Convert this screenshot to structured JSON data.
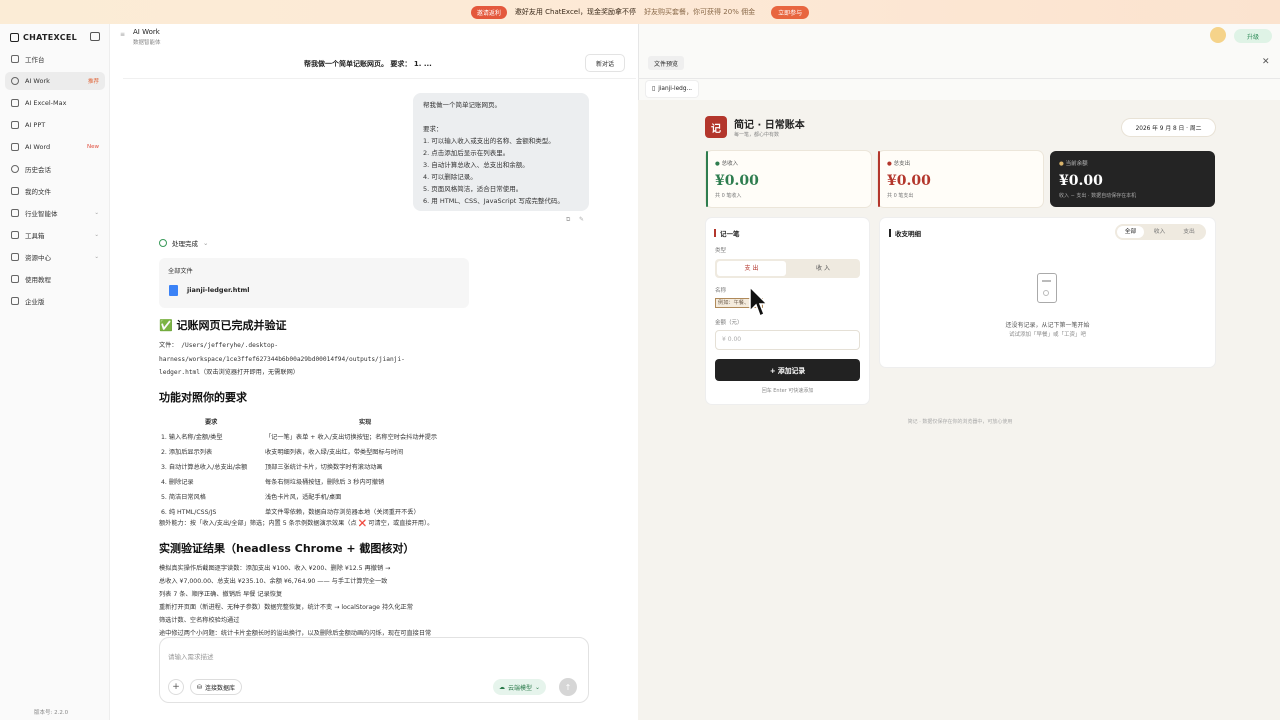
{
  "banner": {
    "tag": "邀请返利",
    "text": "邀好友用 ChatExcel，现金奖励拿不停",
    "sub": "好友购买套餐，你可获得 20% 佣金",
    "cta": "立即参与"
  },
  "sidebar": {
    "logo": "CHATEXCEL",
    "items": [
      {
        "label": "工作台",
        "badge": ""
      },
      {
        "label": "AI Work",
        "badge": "推荐"
      },
      {
        "label": "AI Excel-Max",
        "badge": ""
      },
      {
        "label": "AI PPT",
        "badge": ""
      },
      {
        "label": "AI Word",
        "badge": "New"
      },
      {
        "label": "历史会话",
        "badge": ""
      },
      {
        "label": "我的文件",
        "badge": ""
      },
      {
        "label": "行业智能体",
        "badge": ""
      },
      {
        "label": "工具箱",
        "badge": ""
      },
      {
        "label": "资源中心",
        "badge": ""
      },
      {
        "label": "使用教程",
        "badge": ""
      },
      {
        "label": "企业版",
        "badge": ""
      }
    ],
    "version": "版本号: 2.2.0"
  },
  "chat": {
    "title": "AI Work",
    "subtitle": "数据智能体",
    "conv_title": "帮我做一个简单记账网页。 要求： 1. ...",
    "new_chat": "新对话",
    "user_msg": [
      "帮我做一个简单记账网页。",
      "",
      "要求：",
      "1. 可以输入收入或支出的名称、金额和类型。",
      "2. 点击添加后显示在列表里。",
      "3. 自动计算总收入、总支出和余额。",
      "4. 可以删除记录。",
      "5. 页面风格简洁，适合日常使用。",
      "6. 用 HTML、CSS、JavaScript 写成完整代码。"
    ],
    "status": "处理完成",
    "files_label": "全部文件",
    "file_name": "jianji-ledger.html",
    "h_done": "✅ 记账网页已完成并验证",
    "file_path_1": "文件： /Users/jefferyhe/.desktop-",
    "file_path_2": "harness/workspace/1ce3ffef627344b6b00a29bd00014f94/outputs/jianji-",
    "file_path_3": "ledger.html（双击浏览器打开即用，无需联网）",
    "h_compare": "功能对照你的要求",
    "table_head": [
      "要求",
      "实现"
    ],
    "table_rows": [
      [
        "1. 输入名称/金额/类型",
        "「记一笔」表单 + 收入/支出切换按钮；名称空时会抖动并提示"
      ],
      [
        "2. 添加后显示列表",
        "收支明细列表，收入绿/支出红，带类型图标与时间"
      ],
      [
        "3. 自动计算总收入/总支出/余额",
        "顶部三张统计卡片，切换数字时有滚动动画"
      ],
      [
        "4. 删除记录",
        "每条右侧垃圾桶按钮，删除后 3 秒内可撤销"
      ],
      [
        "5. 简洁日常风格",
        "浅色卡片风，适配手机/桌面"
      ],
      [
        "6. 纯 HTML/CSS/JS",
        "单文件零依赖，数据自动存浏览器本地（关闭重开不丢）"
      ]
    ],
    "extra": "额外能力：按「收入/支出/全部」筛选；内置 5 条示例数据演示效果（点 ❌ 可清空，或直接开用）。",
    "h_verify": "实测验证结果（headless Chrome + 截图核对）",
    "verify_lines": [
      "模拟真实操作后截图逐字读数：添加支出 ¥100、收入 ¥200、删除 ¥12.5 再撤销 →",
      "总收入 ¥7,000.00、总支出 ¥235.10、余额 ¥6,764.90 —— 与手工计算完全一致",
      "列表 7 条、顺序正确、撤销后 早餐 记录恢复",
      "重新打开页面（新进程、无种子参数）数据完整恢复，统计不变 → localStorage 持久化正常",
      "筛选计数、空名称校验均通过",
      "途中修过两个小问题：统计卡片金额长时的溢出换行，以及删除后金额动画的闪烁，现在可直接日常"
    ],
    "input_placeholder": "请输入需求描述",
    "btn_add": "+",
    "btn_data": "连接数据库",
    "btn_model": "云端模型"
  },
  "preview": {
    "tab_label": "文件预览",
    "file_tab": "jianji-ledg...",
    "app_logo": "记",
    "app_title": "简记 · 日常账本",
    "app_sub": "每一笔，都心中有数",
    "date": "2026 年 9 月 8 日 · 周二",
    "stats": [
      {
        "label": "总收入",
        "value": "¥0.00",
        "sub": "共 0 笔收入",
        "color": "#2e7d4f"
      },
      {
        "label": "总支出",
        "value": "¥0.00",
        "sub": "共 0 笔支出",
        "color": "#b3362c"
      },
      {
        "label": "当前余额",
        "value": "¥0.00",
        "sub": "收入 − 支出 · 数据自动保存在本机",
        "color": "#d9b46b"
      }
    ],
    "form_title": "记一笔",
    "type_label": "类型",
    "type_opts": [
      "支 出",
      "收 入"
    ],
    "name_label": "名称",
    "name_placeholder": "例如：午餐、工资",
    "amount_label": "金额（元）",
    "amount_placeholder": "¥  0.00",
    "add_btn": "+ 添加记录",
    "hint": "回车 Enter 可快速添加",
    "list_title": "收支明细",
    "filters": [
      "全部",
      "收入",
      "支出"
    ],
    "empty_title": "还没有记录，从记下第一笔开始",
    "empty_sub": "试试添加「早餐」或「工资」吧",
    "footer": "简记 · 数据仅保存在你的浏览器中，可放心使用"
  },
  "top_right": {
    "upgrade": "升级"
  }
}
